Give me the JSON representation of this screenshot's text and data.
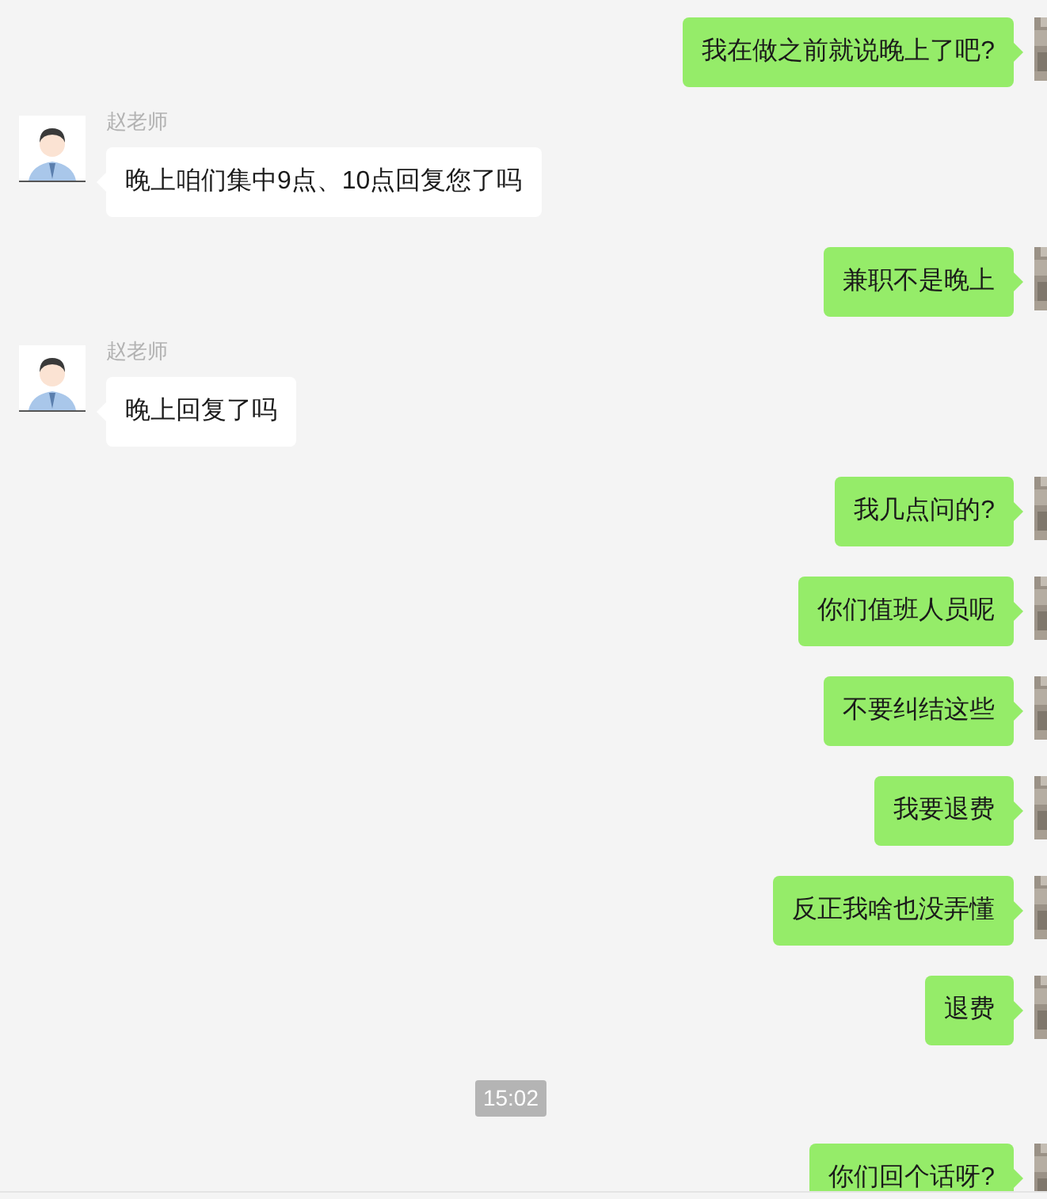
{
  "messages": [
    {
      "kind": "sent",
      "text": "我在做之前就说晚上了吧?"
    },
    {
      "kind": "received",
      "sender": "赵老师",
      "text": "晚上咱们集中9点、10点回复您了吗"
    },
    {
      "kind": "sent",
      "text": "兼职不是晚上"
    },
    {
      "kind": "received",
      "sender": "赵老师",
      "text": "晚上回复了吗"
    },
    {
      "kind": "sent",
      "text": "我几点问的?"
    },
    {
      "kind": "sent",
      "text": "你们值班人员呢"
    },
    {
      "kind": "sent",
      "text": "不要纠结这些"
    },
    {
      "kind": "sent",
      "text": "我要退费"
    },
    {
      "kind": "sent",
      "text": "反正我啥也没弄懂"
    },
    {
      "kind": "sent",
      "text": "退费"
    },
    {
      "kind": "time",
      "text": "15:02"
    },
    {
      "kind": "sent",
      "text": "你们回个话呀?"
    }
  ]
}
